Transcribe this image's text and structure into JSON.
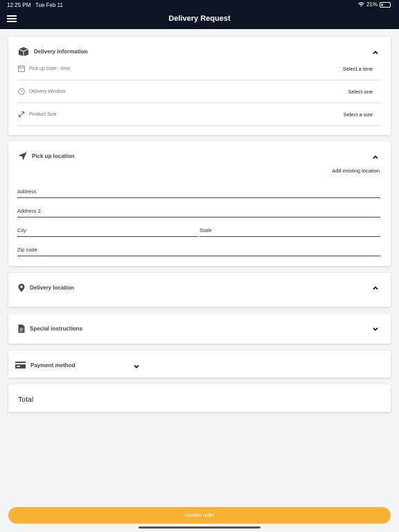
{
  "status": {
    "time": "12:25 PM",
    "date": "Tue Feb 11",
    "battery": "21%",
    "battery_level": 0.21
  },
  "header": {
    "title": "Delivery Request"
  },
  "delivery_info": {
    "label": "Delivery information",
    "rows": [
      {
        "label": "Pick up Date - time",
        "action": "Select a time",
        "icon": "calendar-icon"
      },
      {
        "label": "Delivery Window",
        "action": "Select one",
        "icon": "clock-icon"
      },
      {
        "label": "Product Size",
        "action": "Select a size",
        "icon": "resize-icon"
      }
    ]
  },
  "pickup": {
    "label": "Pick up location",
    "add_existing": "Add existing location",
    "fields": {
      "address": "Address",
      "address2": "Address 2",
      "city": "City",
      "state": "State",
      "zip": "Zip code"
    }
  },
  "delivery_location": {
    "label": "Delivery location"
  },
  "special": {
    "label": "Special instructions"
  },
  "payment": {
    "label": "Payment method"
  },
  "total": {
    "label": "Total"
  },
  "confirm": {
    "label": "Confirm order"
  },
  "colors": {
    "header_bg": "#0d1424",
    "accent": "#f9b233",
    "field_line": "#3a4a66"
  }
}
